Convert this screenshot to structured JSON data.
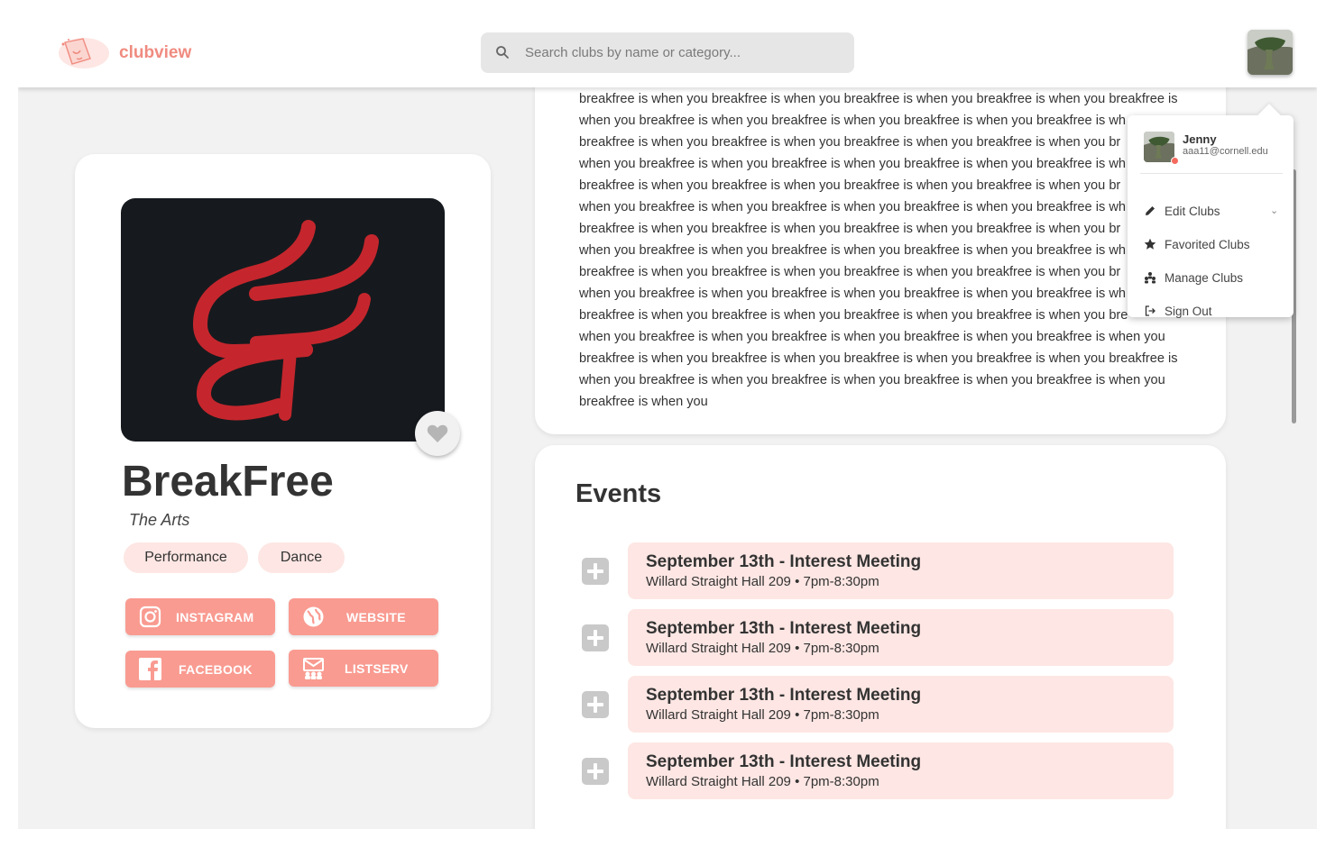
{
  "app": {
    "brand": "clubview"
  },
  "search": {
    "placeholder": "Search clubs by name or category..."
  },
  "user": {
    "name": "Jenny",
    "email": "aaa11@cornell.edu"
  },
  "user_menu": {
    "items": [
      {
        "label": "Edit Clubs",
        "icon": "pencil-icon",
        "has_chevron": true
      },
      {
        "label": "Favorited Clubs",
        "icon": "star-icon"
      },
      {
        "label": "Manage Clubs",
        "icon": "people-icon"
      },
      {
        "label": "Sign Out",
        "icon": "sign-out-icon"
      }
    ]
  },
  "club": {
    "name": "BreakFree",
    "category": "The Arts",
    "tags": [
      "Performance",
      "Dance"
    ],
    "links": [
      "INSTAGRAM",
      "WEBSITE",
      "FACEBOOK",
      "LISTSERV"
    ],
    "logo_colors": {
      "background": "#161a1e",
      "mark": "#c5262d"
    }
  },
  "description": {
    "lines": [
      "breakfree is when you breakfree is when you breakfree is when you breakfree is when you breakfree is",
      "when you breakfree is when you breakfree is when you breakfree is when you breakfree is wh",
      "breakfree is when you breakfree is when you breakfree is when you breakfree is when you br",
      "when you breakfree is when you breakfree is when you breakfree is when you breakfree is wh",
      "breakfree is when you breakfree is when you breakfree is when you breakfree is when you br",
      "when you breakfree is when you breakfree is when you breakfree is when you breakfree is wh",
      "breakfree is when you breakfree is when you breakfree is when you breakfree is when you br",
      "when you breakfree is when you breakfree is when you breakfree is when you breakfree is wh",
      "breakfree is when you breakfree is when you breakfree is when you breakfree is when you br",
      "when you breakfree is when you breakfree is when you breakfree is when you breakfree is wh",
      "breakfree is when you breakfree is when you breakfree is when you breakfree is when you bre",
      "when you breakfree is when you breakfree is when you breakfree is when you breakfree is when you",
      "breakfree is when you breakfree is when you breakfree is when you breakfree is when you breakfree is",
      "when you breakfree is when you breakfree is when you breakfree is when you breakfree is when you",
      "breakfree is when you"
    ]
  },
  "events": {
    "title": "Events",
    "items": [
      {
        "title": "September 13th - Interest Meeting",
        "details": "Willard Straight Hall 209 • 7pm-8:30pm"
      },
      {
        "title": "September 13th - Interest Meeting",
        "details": "Willard Straight Hall 209 • 7pm-8:30pm"
      },
      {
        "title": "September 13th - Interest Meeting",
        "details": "Willard Straight Hall 209 • 7pm-8:30pm"
      },
      {
        "title": "September 13th - Interest Meeting",
        "details": "Willard Straight Hall 209 • 7pm-8:30pm"
      }
    ]
  },
  "colors": {
    "accent": "#f99b91",
    "brand": "#f08b80",
    "tag_bg": "#fde6e3",
    "event_bg": "#fde6e3"
  }
}
